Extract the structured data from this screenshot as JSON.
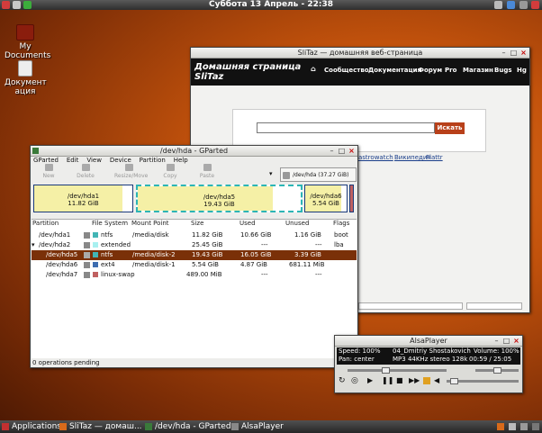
{
  "panel": {
    "clock": "Суббота 13 Апрель - 22:38"
  },
  "desktop_icons": [
    {
      "label_line1": "My",
      "label_line2": "Documents"
    },
    {
      "label_line1": "Документ",
      "label_line2": "ация"
    }
  ],
  "browser": {
    "title": "SliTaz — домашняя веб-страница",
    "site_title_1": "Домашняя страница",
    "site_title_2": "SliTaz",
    "nav": [
      "Сообщество",
      "Документация",
      "Форум",
      "Pro",
      "Магазин",
      "Bugs",
      "Hg"
    ],
    "search_button": "Искать",
    "links": [
      "astrowatch",
      "Википедия",
      "Flattr"
    ]
  },
  "gparted": {
    "title": "/dev/hda - GParted",
    "menu": [
      "GParted",
      "Edit",
      "View",
      "Device",
      "Partition",
      "Help"
    ],
    "toolbar": [
      "New",
      "Delete",
      "Resize/Move",
      "Copy",
      "Paste"
    ],
    "device_selector": "/dev/hda  (37.27 GiB)",
    "segments": [
      {
        "name": "/dev/hda1",
        "size": "11.82 GiB",
        "used_fraction": 0.9
      },
      {
        "name": "/dev/hda5",
        "size": "19.43 GiB",
        "used_fraction": 0.83
      },
      {
        "name": "/dev/hda6",
        "size": "5.54 GiB",
        "used_fraction": 0.88
      }
    ],
    "columns": [
      "Partition",
      "File System",
      "Mount Point",
      "Size",
      "Used",
      "Unused",
      "Flags"
    ],
    "rows": [
      {
        "partition": "/dev/hda1",
        "fs": "ntfs",
        "fs_color": "#42b5b5",
        "mount": "/media/disk",
        "size": "11.82 GiB",
        "used": "10.66 GiB",
        "unused": "1.16 GiB",
        "flags": "boot"
      },
      {
        "partition": "/dev/hda2",
        "fs": "extended",
        "fs_color": "#a8f0f0",
        "mount": "",
        "size": "25.45 GiB",
        "used": "---",
        "unused": "---",
        "flags": "lba"
      },
      {
        "partition": "/dev/hda5",
        "fs": "ntfs",
        "fs_color": "#42b5b5",
        "mount": "/media/disk-2",
        "size": "19.43 GiB",
        "used": "16.05 GiB",
        "unused": "3.39 GiB",
        "flags": ""
      },
      {
        "partition": "/dev/hda6",
        "fs": "ext4",
        "fs_color": "#3e6db0",
        "mount": "/media/disk-1",
        "size": "5.54 GiB",
        "used": "4.87 GiB",
        "unused": "681.11 MiB",
        "flags": ""
      },
      {
        "partition": "/dev/hda7",
        "fs": "linux-swap",
        "fs_color": "#c06060",
        "mount": "",
        "size": "489.00 MiB",
        "used": "---",
        "unused": "---",
        "flags": ""
      }
    ],
    "status": "0 operations pending"
  },
  "alsa": {
    "title": "AlsaPlayer",
    "speed": "Speed: 100%",
    "track": "04_Dmitriy Shostakovich",
    "volume": "Volume: 100%",
    "pan": "Pan: center",
    "format": "MP3 44KHz stereo 128k",
    "time": "00:59 / 25:05"
  },
  "taskbar": {
    "apps": "Applications",
    "tasks": [
      "SliTaz — домаш...",
      "/dev/hda - GParted",
      "AlsaPlayer"
    ]
  },
  "colors": {
    "accent": "#7a3008",
    "panel": "#2e2e2e"
  }
}
